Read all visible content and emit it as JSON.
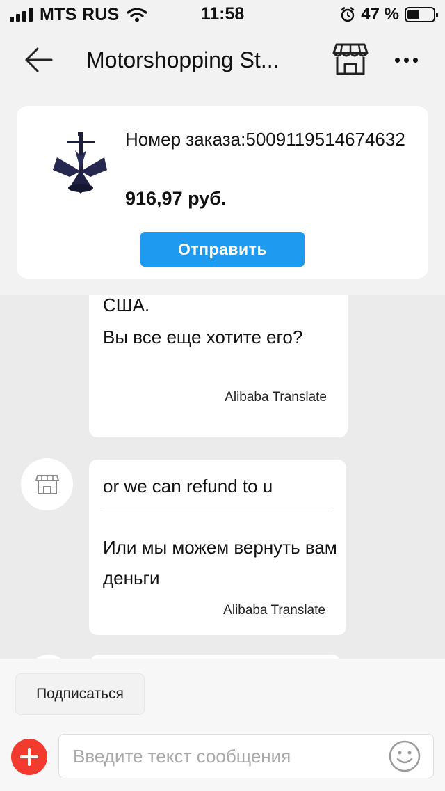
{
  "status_bar": {
    "carrier": "MTS RUS",
    "time": "11:58",
    "battery_percent": "47 %",
    "battery_level": 0.47,
    "icons": [
      "signal-icon",
      "wifi-icon",
      "alarm-icon",
      "battery-icon"
    ]
  },
  "header": {
    "title": "Motorshopping St...",
    "icons": [
      "back-arrow-icon",
      "store-icon",
      "more-icon"
    ]
  },
  "order": {
    "number_text": "Номер заказа:5009119514674632",
    "price": "916,97 руб.",
    "send_label": "Отправить",
    "thumbnail": "anchor-product-icon",
    "send_color": "#1e9bf0"
  },
  "messages": [
    {
      "cut_text": "... ... ...",
      "lines": [
        "США.",
        "Вы все еще хотите его?"
      ],
      "translator": "Alibaba Translate"
    },
    {
      "original": "or we can refund to u",
      "translated": "Или мы можем вернуть вам деньги",
      "translator": "Alibaba Translate",
      "avatar": "store-avatar-icon"
    }
  ],
  "bottom": {
    "subscribe_label": "Подписаться",
    "input_placeholder": "Введите текст сообщения",
    "plus_color": "#f23a2f",
    "icons": [
      "plus-icon",
      "emoji-icon"
    ]
  }
}
